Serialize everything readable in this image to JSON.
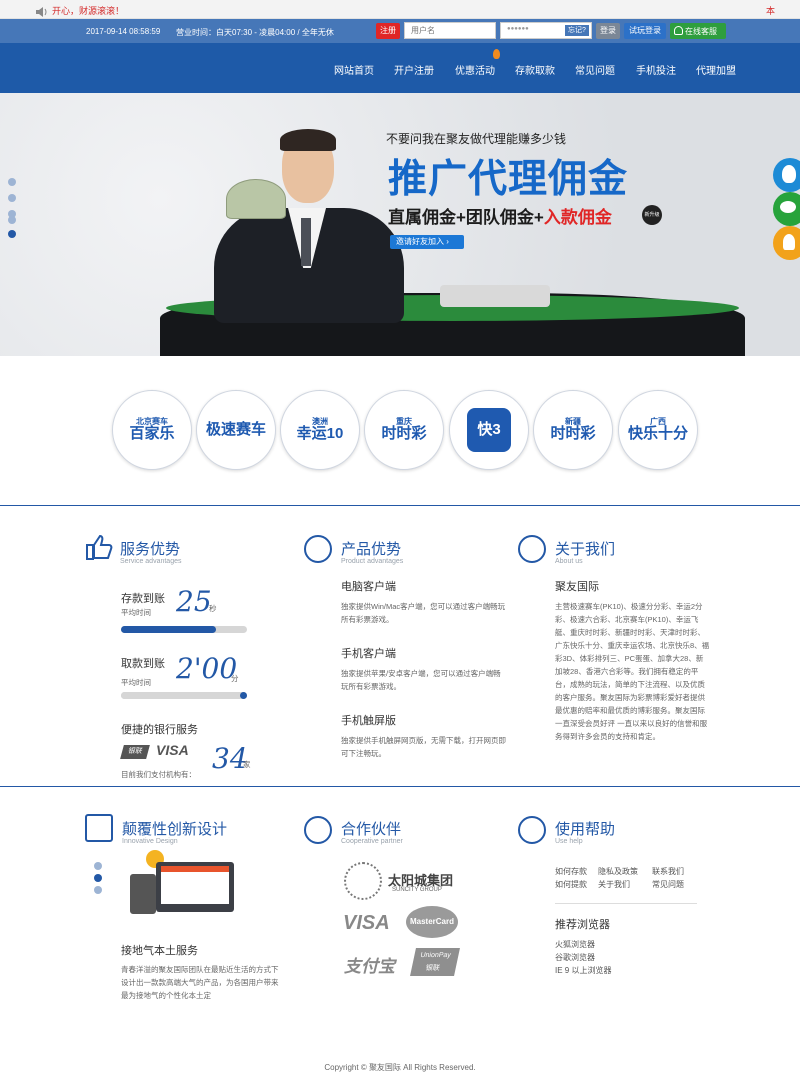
{
  "topbar": {
    "marquee": "开心，财源滚滚！",
    "right": "本"
  },
  "status": {
    "datetime": "2017-09-14 08:58:59",
    "hours": "营业时间：白天07:30 - 凌晨04:00 / 全年无休"
  },
  "login": {
    "register": "注册",
    "username_placeholder": "用户名",
    "password_value": "●●●●●●",
    "forgot": "忘记?",
    "login": "登录",
    "trial": "试玩登录",
    "service": "在线客服"
  },
  "nav": [
    "网站首页",
    "开户注册",
    "优惠活动",
    "存款取款",
    "常见问题",
    "手机投注",
    "代理加盟"
  ],
  "banner": {
    "line1": "不要问我在聚友做代理能赚多少钱",
    "headline": "推广代理佣金",
    "line3a": "直属佣金+团队佣金+",
    "line3b": "入款佣金",
    "badge": "新升级",
    "cta": "邀请好友加入 ›"
  },
  "lotteries": [
    {
      "small": "北京赛车",
      "big": "百家乐"
    },
    {
      "small": "",
      "big": "极速赛车"
    },
    {
      "small": "澳洲",
      "big": "幸运10"
    },
    {
      "small": "重庆",
      "big": "时时彩"
    },
    {
      "small": "",
      "big": "快3"
    },
    {
      "small": "新疆",
      "big": "时时彩"
    },
    {
      "small": "广西",
      "big": "快乐十分"
    }
  ],
  "service": {
    "title": "服务优势",
    "sub": "Service advantages",
    "deposit_label": "存款到账",
    "deposit_value": "25",
    "deposit_unit": "秒",
    "deposit_avg": "平均时间",
    "deposit_progress": 0.78,
    "withdraw_label": "取款到账",
    "withdraw_value": "2'00",
    "withdraw_unit": "分",
    "withdraw_avg": "平均时间",
    "withdraw_progress": 1.0,
    "bank_label": "便捷的银行服务",
    "visa": "VISA",
    "unionpay": "银联",
    "bank_count": "34",
    "bank_unit": "家",
    "bank_text": "目前我们支付机构有："
  },
  "product": {
    "title": "产品优势",
    "sub": "Product advantages",
    "items": [
      {
        "h": "电脑客户端",
        "t": "独家提供Win/Mac客户端，您可以通过客户端畅玩所有彩票游戏。"
      },
      {
        "h": "手机客户端",
        "t": "独家提供苹果/安卓客户端，您可以通过客户端畅玩所有彩票游戏。"
      },
      {
        "h": "手机触屏版",
        "t": "独家提供手机触屏网页版，无需下载，打开网页即可下注畅玩。"
      }
    ]
  },
  "about": {
    "title": "关于我们",
    "sub": "About us",
    "name": "聚友国际",
    "text": "主营极速赛车(PK10)、极速分分彩、幸运2分彩、极速六合彩、北京赛车(PK10)、幸运飞艇、重庆时时彩、新疆时时彩、天津时时彩、广东快乐十分、重庆幸运农场、北京快乐8、福彩3D、体彩排列三、PC蛋蛋、加拿大28、新加坡28、香港六合彩等。我们拥有稳定的平台，成熟的玩法，简单的下注流程、以及优质的客户服务。聚友国际为彩票博彩爱好者提供最优惠的赔率和最优质的博彩服务。聚友国际一直深受会员好评 一直以来以良好的信誉和服务得到许多会员的支持和肯定。"
  },
  "design": {
    "title": "颠覆性创新设计",
    "sub": "Innovative Design",
    "h": "接地气本土服务",
    "t": "青春洋溢的聚友国际团队在最贴近生活的方式下设计出一款款高端大气的产品，为各国用户带来最为接地气的个性化本土定"
  },
  "partner": {
    "title": "合作伙伴",
    "sub": "Cooperative partner",
    "p1": "太阳城集团",
    "p1sub": "SUNCITY GROUP",
    "p2": "VISA",
    "p3": "MasterCard",
    "p4": "支付宝",
    "p5": "UnionPay",
    "p5b": "银联"
  },
  "help": {
    "title": "使用帮助",
    "sub": "Use help",
    "links": [
      [
        "如何存款",
        "隐私及政策",
        "联系我们"
      ],
      [
        "如何提款",
        "关于我们",
        "常见问题"
      ]
    ],
    "browser_title": "推荐浏览器",
    "browsers": [
      "火狐浏览器",
      "谷歌浏览器",
      "IE 9 以上浏览器"
    ]
  },
  "footer": {
    "copyright": "Copyright © 聚友国际 All Rights Reserved."
  },
  "colors": {
    "primary": "#2358a6",
    "nav": "#1e5aa8",
    "status": "#4677b8",
    "red": "#e02626",
    "green": "#2e9e3e"
  }
}
